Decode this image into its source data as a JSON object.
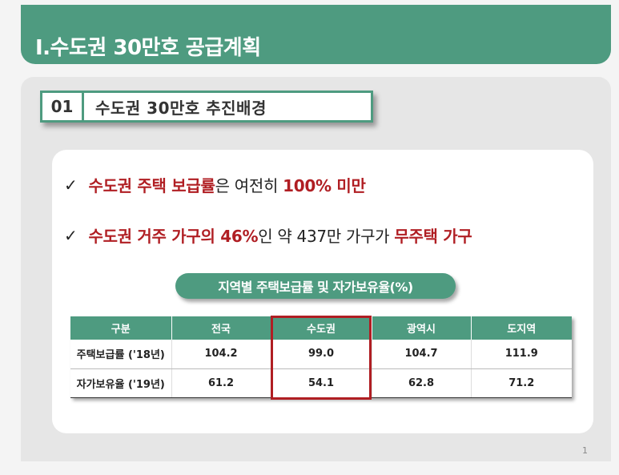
{
  "header": {
    "title": "Ⅰ.수도권 30만호 공급계획"
  },
  "section": {
    "number": "01",
    "title": "수도권 30만호 추진배경"
  },
  "bullets": [
    {
      "check": "✓",
      "a": "수도권 주택 보급률",
      "b": "은 여전히 ",
      "c": "100% 미만"
    },
    {
      "check": "✓",
      "a": "수도권 거주 가구의 46%",
      "b": "인 약 437만 가구가 ",
      "c": "무주택 가구"
    }
  ],
  "table": {
    "caption": "지역별 주택보급률 및 자가보유율(%)",
    "headers": [
      "구분",
      "전국",
      "수도권",
      "광역시",
      "도지역"
    ],
    "rows": [
      [
        "주택보급률 ('18년)",
        "104.2",
        "99.0",
        "104.7",
        "111.9"
      ],
      [
        "자가보유율 ('19년)",
        "61.2",
        "54.1",
        "62.8",
        "71.2"
      ]
    ]
  },
  "page_number": "1",
  "colors": {
    "green": "#4e9b80",
    "red": "#b01e23"
  }
}
